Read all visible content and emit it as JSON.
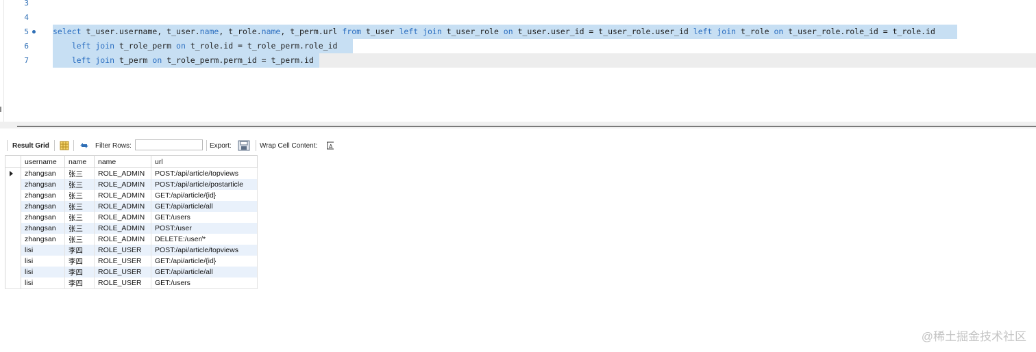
{
  "editor": {
    "line_numbers": [
      "3",
      "4",
      "5",
      "6",
      "7"
    ],
    "line5": {
      "t1": "select",
      "t2": " t_user.username, t_user.",
      "t3": "name",
      "t4": ", t_role.",
      "t5": "name",
      "t6": ", t_perm.url ",
      "t7": "from",
      "t8": " t_user ",
      "t9": "left join",
      "t10": " t_user_role ",
      "t11": "on",
      "t12": " t_user.user_id = t_user_role.user_id ",
      "t13": "left join",
      "t14": " t_role ",
      "t15": "on",
      "t16": " t_user_role.role_id = t_role.id"
    },
    "line6": {
      "t1": "    ",
      "t2": "left join",
      "t3": " t_role_perm ",
      "t4": "on",
      "t5": " t_role.id = t_role_perm.role_id "
    },
    "line7": {
      "t1": "    ",
      "t2": "left join",
      "t3": " t_perm ",
      "t4": "on",
      "t5": " t_role_perm.perm_id = t_perm.id"
    }
  },
  "toolbar": {
    "result_grid": "Result Grid",
    "filter_rows": "Filter Rows:",
    "filter_value": "",
    "export": "Export:",
    "wrap_cell": "Wrap Cell Content:",
    "icons": [
      "grid-form-icon",
      "refresh-icon",
      "export-icon",
      "wrap-icon"
    ]
  },
  "grid": {
    "columns": [
      "username",
      "name",
      "name",
      "url"
    ],
    "rows": [
      [
        "zhangsan",
        "张三",
        "ROLE_ADMIN",
        "POST:/api/article/topviews"
      ],
      [
        "zhangsan",
        "张三",
        "ROLE_ADMIN",
        "POST:/api/article/postarticle"
      ],
      [
        "zhangsan",
        "张三",
        "ROLE_ADMIN",
        "GET:/api/article/{id}"
      ],
      [
        "zhangsan",
        "张三",
        "ROLE_ADMIN",
        "GET:/api/article/all"
      ],
      [
        "zhangsan",
        "张三",
        "ROLE_ADMIN",
        "GET:/users"
      ],
      [
        "zhangsan",
        "张三",
        "ROLE_ADMIN",
        "POST:/user"
      ],
      [
        "zhangsan",
        "张三",
        "ROLE_ADMIN",
        "DELETE:/user/*"
      ],
      [
        "lisi",
        "李四",
        "ROLE_USER",
        "POST:/api/article/topviews"
      ],
      [
        "lisi",
        "李四",
        "ROLE_USER",
        "GET:/api/article/{id}"
      ],
      [
        "lisi",
        "李四",
        "ROLE_USER",
        "GET:/api/article/all"
      ],
      [
        "lisi",
        "李四",
        "ROLE_USER",
        "GET:/users"
      ]
    ]
  },
  "watermark": "@稀土掘金技术社区",
  "colors": {
    "keyword": "#2c6fc1",
    "selection": "#c7dff3",
    "alt_row": "#e9f1fb"
  }
}
